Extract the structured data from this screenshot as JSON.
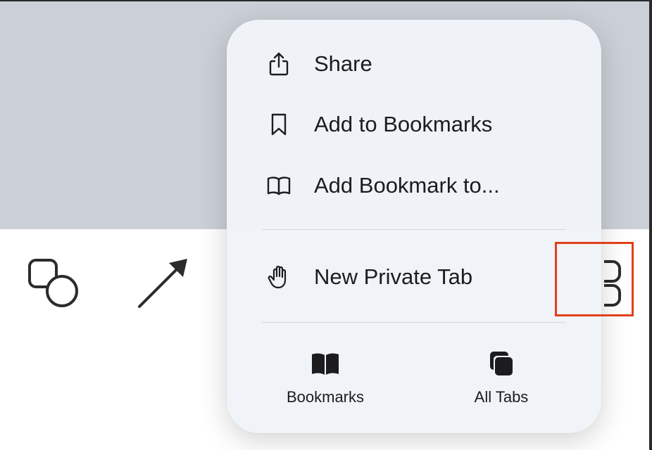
{
  "menu": {
    "items": [
      {
        "label": "Share",
        "icon": "share-icon"
      },
      {
        "label": "Add to Bookmarks",
        "icon": "bookmark-icon"
      },
      {
        "label": "Add Bookmark to...",
        "icon": "book-open-icon"
      },
      {
        "label": "New Private Tab",
        "icon": "hand-icon"
      }
    ],
    "bottom": [
      {
        "label": "Bookmarks",
        "icon": "book-filled-icon"
      },
      {
        "label": "All Tabs",
        "icon": "tabs-stack-icon"
      }
    ]
  },
  "toolbar": {
    "icons": [
      "shapes-icon",
      "arrow-icon",
      "tab-overview-icon"
    ]
  },
  "colors": {
    "top_background": "#cbd0d8",
    "menu_background": "#f0f3f8",
    "highlight": "#e0401c",
    "text": "#1c1c1e"
  }
}
